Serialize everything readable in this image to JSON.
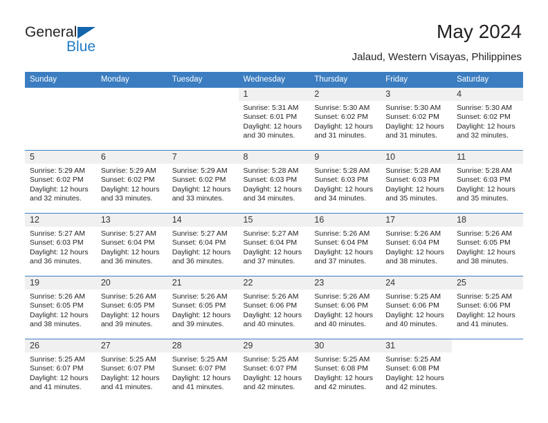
{
  "brand": {
    "name_top": "General",
    "name_bottom": "Blue",
    "triangle_color": "#1465ab",
    "blue_text_color": "#1f7ac4"
  },
  "header": {
    "title": "May 2024",
    "subtitle": "Jalaud, Western Visayas, Philippines",
    "accent_color": "#3b7dc0",
    "datenum_band_color": "#f0f0f0"
  },
  "weekdays": [
    "Sunday",
    "Monday",
    "Tuesday",
    "Wednesday",
    "Thursday",
    "Friday",
    "Saturday"
  ],
  "weeks": [
    [
      {
        "empty": true
      },
      {
        "empty": true
      },
      {
        "empty": true
      },
      {
        "date": "1",
        "sunrise": "Sunrise: 5:31 AM",
        "sunset": "Sunset: 6:01 PM",
        "daylight": "Daylight: 12 hours and 30 minutes."
      },
      {
        "date": "2",
        "sunrise": "Sunrise: 5:30 AM",
        "sunset": "Sunset: 6:02 PM",
        "daylight": "Daylight: 12 hours and 31 minutes."
      },
      {
        "date": "3",
        "sunrise": "Sunrise: 5:30 AM",
        "sunset": "Sunset: 6:02 PM",
        "daylight": "Daylight: 12 hours and 31 minutes."
      },
      {
        "date": "4",
        "sunrise": "Sunrise: 5:30 AM",
        "sunset": "Sunset: 6:02 PM",
        "daylight": "Daylight: 12 hours and 32 minutes."
      }
    ],
    [
      {
        "date": "5",
        "sunrise": "Sunrise: 5:29 AM",
        "sunset": "Sunset: 6:02 PM",
        "daylight": "Daylight: 12 hours and 32 minutes."
      },
      {
        "date": "6",
        "sunrise": "Sunrise: 5:29 AM",
        "sunset": "Sunset: 6:02 PM",
        "daylight": "Daylight: 12 hours and 33 minutes."
      },
      {
        "date": "7",
        "sunrise": "Sunrise: 5:29 AM",
        "sunset": "Sunset: 6:02 PM",
        "daylight": "Daylight: 12 hours and 33 minutes."
      },
      {
        "date": "8",
        "sunrise": "Sunrise: 5:28 AM",
        "sunset": "Sunset: 6:03 PM",
        "daylight": "Daylight: 12 hours and 34 minutes."
      },
      {
        "date": "9",
        "sunrise": "Sunrise: 5:28 AM",
        "sunset": "Sunset: 6:03 PM",
        "daylight": "Daylight: 12 hours and 34 minutes."
      },
      {
        "date": "10",
        "sunrise": "Sunrise: 5:28 AM",
        "sunset": "Sunset: 6:03 PM",
        "daylight": "Daylight: 12 hours and 35 minutes."
      },
      {
        "date": "11",
        "sunrise": "Sunrise: 5:28 AM",
        "sunset": "Sunset: 6:03 PM",
        "daylight": "Daylight: 12 hours and 35 minutes."
      }
    ],
    [
      {
        "date": "12",
        "sunrise": "Sunrise: 5:27 AM",
        "sunset": "Sunset: 6:03 PM",
        "daylight": "Daylight: 12 hours and 36 minutes."
      },
      {
        "date": "13",
        "sunrise": "Sunrise: 5:27 AM",
        "sunset": "Sunset: 6:04 PM",
        "daylight": "Daylight: 12 hours and 36 minutes."
      },
      {
        "date": "14",
        "sunrise": "Sunrise: 5:27 AM",
        "sunset": "Sunset: 6:04 PM",
        "daylight": "Daylight: 12 hours and 36 minutes."
      },
      {
        "date": "15",
        "sunrise": "Sunrise: 5:27 AM",
        "sunset": "Sunset: 6:04 PM",
        "daylight": "Daylight: 12 hours and 37 minutes."
      },
      {
        "date": "16",
        "sunrise": "Sunrise: 5:26 AM",
        "sunset": "Sunset: 6:04 PM",
        "daylight": "Daylight: 12 hours and 37 minutes."
      },
      {
        "date": "17",
        "sunrise": "Sunrise: 5:26 AM",
        "sunset": "Sunset: 6:04 PM",
        "daylight": "Daylight: 12 hours and 38 minutes."
      },
      {
        "date": "18",
        "sunrise": "Sunrise: 5:26 AM",
        "sunset": "Sunset: 6:05 PM",
        "daylight": "Daylight: 12 hours and 38 minutes."
      }
    ],
    [
      {
        "date": "19",
        "sunrise": "Sunrise: 5:26 AM",
        "sunset": "Sunset: 6:05 PM",
        "daylight": "Daylight: 12 hours and 38 minutes."
      },
      {
        "date": "20",
        "sunrise": "Sunrise: 5:26 AM",
        "sunset": "Sunset: 6:05 PM",
        "daylight": "Daylight: 12 hours and 39 minutes."
      },
      {
        "date": "21",
        "sunrise": "Sunrise: 5:26 AM",
        "sunset": "Sunset: 6:05 PM",
        "daylight": "Daylight: 12 hours and 39 minutes."
      },
      {
        "date": "22",
        "sunrise": "Sunrise: 5:26 AM",
        "sunset": "Sunset: 6:06 PM",
        "daylight": "Daylight: 12 hours and 40 minutes."
      },
      {
        "date": "23",
        "sunrise": "Sunrise: 5:26 AM",
        "sunset": "Sunset: 6:06 PM",
        "daylight": "Daylight: 12 hours and 40 minutes."
      },
      {
        "date": "24",
        "sunrise": "Sunrise: 5:25 AM",
        "sunset": "Sunset: 6:06 PM",
        "daylight": "Daylight: 12 hours and 40 minutes."
      },
      {
        "date": "25",
        "sunrise": "Sunrise: 5:25 AM",
        "sunset": "Sunset: 6:06 PM",
        "daylight": "Daylight: 12 hours and 41 minutes."
      }
    ],
    [
      {
        "date": "26",
        "sunrise": "Sunrise: 5:25 AM",
        "sunset": "Sunset: 6:07 PM",
        "daylight": "Daylight: 12 hours and 41 minutes."
      },
      {
        "date": "27",
        "sunrise": "Sunrise: 5:25 AM",
        "sunset": "Sunset: 6:07 PM",
        "daylight": "Daylight: 12 hours and 41 minutes."
      },
      {
        "date": "28",
        "sunrise": "Sunrise: 5:25 AM",
        "sunset": "Sunset: 6:07 PM",
        "daylight": "Daylight: 12 hours and 41 minutes."
      },
      {
        "date": "29",
        "sunrise": "Sunrise: 5:25 AM",
        "sunset": "Sunset: 6:07 PM",
        "daylight": "Daylight: 12 hours and 42 minutes."
      },
      {
        "date": "30",
        "sunrise": "Sunrise: 5:25 AM",
        "sunset": "Sunset: 6:08 PM",
        "daylight": "Daylight: 12 hours and 42 minutes."
      },
      {
        "date": "31",
        "sunrise": "Sunrise: 5:25 AM",
        "sunset": "Sunset: 6:08 PM",
        "daylight": "Daylight: 12 hours and 42 minutes."
      },
      {
        "empty": true
      }
    ]
  ]
}
